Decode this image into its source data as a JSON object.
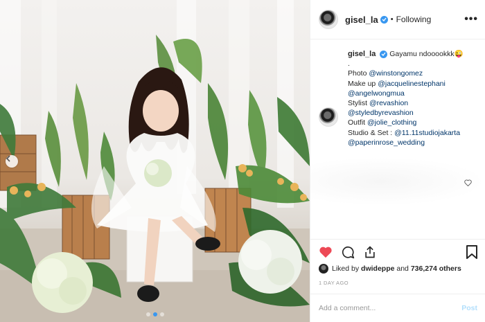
{
  "header": {
    "username": "gisel_la",
    "separator": "•",
    "follow_status": "Following",
    "more": "•••"
  },
  "caption": {
    "username": "gisel_la",
    "text": "Gayamu ndooookkk😜",
    "dot": ".",
    "photo_label": "Photo",
    "photo_link": "@winstongomez",
    "makeup_label": "Make up",
    "makeup_link_1": "@jacquelinestephani",
    "makeup_link_2": "@angelwongmua",
    "stylist_label": "Stylist",
    "stylist_link_1": "@revashion",
    "stylist_link_2": "@styledbyrevashion",
    "outfit_label": "Outfit",
    "outfit_link": "@jolie_clothing",
    "studio_label": "Studio & Set :",
    "studio_link_1": "@11.11studiojakarta",
    "studio_link_2": "@paperinrose_wedding",
    "time": "1d"
  },
  "likes": {
    "prefix": "Liked by",
    "user": "dwideppe",
    "conj": "and",
    "count": "736,274 others"
  },
  "timestamp": "1 DAY AGO",
  "comment": {
    "placeholder": "Add a comment...",
    "post_label": "Post"
  },
  "carousel": {
    "slides": 3,
    "active": 2
  },
  "colors": {
    "accent": "#3897f0",
    "like_red": "#ed4956",
    "link": "#003569"
  },
  "icons": [
    "chevron-left-icon",
    "more-icon",
    "verified-icon",
    "heart-icon",
    "comment-icon",
    "share-icon",
    "bookmark-icon",
    "heart-outline-icon"
  ]
}
